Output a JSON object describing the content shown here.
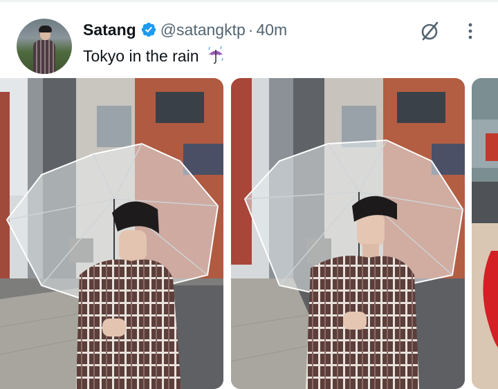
{
  "tweet": {
    "author": {
      "display_name": "Satang",
      "handle": "@satangktp",
      "verified": true,
      "verified_badge_color": "#1d9bf0"
    },
    "separator": "·",
    "timestamp": "40m",
    "text": "Tokyo in the rain",
    "emoji": "umbrella-with-rain-drops",
    "actions": {
      "grok_icon": "grok-slash-circle-icon",
      "more_icon": "more-vertical-dots-icon"
    },
    "media": {
      "photos": [
        {
          "subject": "photo-umbrella-street-1"
        },
        {
          "subject": "photo-umbrella-street-2"
        },
        {
          "subject": "photo-partial-3"
        }
      ]
    }
  },
  "colors": {
    "text_primary": "#0f1419",
    "text_secondary": "#536471",
    "accent": "#1d9bf0"
  }
}
